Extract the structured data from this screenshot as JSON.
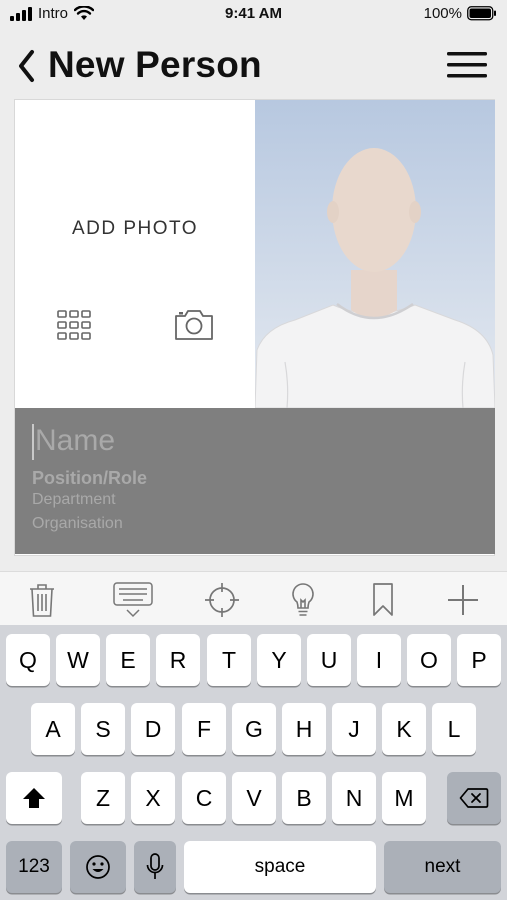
{
  "status_bar": {
    "carrier": "Intro",
    "time": "9:41 AM",
    "battery": "100%"
  },
  "nav": {
    "title": "New Person",
    "back_icon": "chevron-left-icon",
    "menu_icon": "hamburger-menu-icon"
  },
  "card": {
    "add_photo_label": "ADD PHOTO",
    "name_placeholder": "Name",
    "role_placeholder": "Position/Role",
    "department_placeholder": "Department",
    "organisation_placeholder": "Organisation"
  },
  "toolbar": {
    "items": [
      "trash-icon",
      "keyboard-dismiss-icon",
      "crosshair-icon",
      "lightbulb-icon",
      "bookmark-icon",
      "plus-icon"
    ]
  },
  "keyboard": {
    "row1": [
      "Q",
      "W",
      "E",
      "R",
      "T",
      "Y",
      "U",
      "I",
      "O",
      "P"
    ],
    "row2": [
      "A",
      "S",
      "D",
      "F",
      "G",
      "H",
      "J",
      "K",
      "L"
    ],
    "row3": [
      "Z",
      "X",
      "C",
      "V",
      "B",
      "N",
      "M"
    ],
    "numbers_label": "123",
    "space_label": "space",
    "next_label": "next"
  }
}
